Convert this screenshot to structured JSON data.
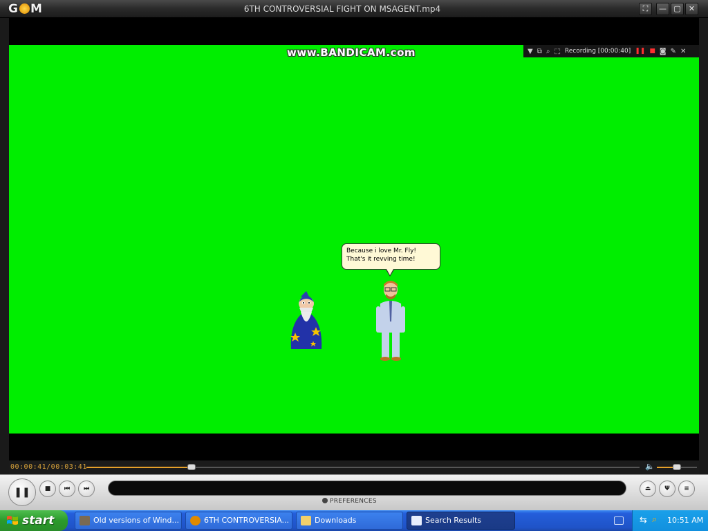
{
  "window": {
    "logo": "GOM",
    "title": "6TH CONTROVERSIAL FIGHT ON MSAGENT.mp4",
    "buttons": {
      "fullscreen": "⛶",
      "minimize": "—",
      "maximize": "▢",
      "close": "✕"
    }
  },
  "video": {
    "watermark": "www.BANDICAM.com",
    "recording_bar": {
      "status_text": "Recording [00:00:40]"
    },
    "speech_bubble": "Because i love Mr. Fly! That's it revving time!",
    "characters": [
      "wizard",
      "businessman"
    ]
  },
  "playback": {
    "timecode": "00:00:41/00:03:41",
    "progress_fraction": 0.19,
    "volume_fraction": 0.5,
    "preferences_label": "PREFERENCES"
  },
  "taskbar": {
    "start_label": "start",
    "tasks": [
      {
        "label": "Old versions of Wind...",
        "active": false
      },
      {
        "label": "6TH CONTROVERSIA...",
        "active": false
      },
      {
        "label": "Downloads",
        "active": false
      },
      {
        "label": "Search Results",
        "active": true
      }
    ],
    "clock": "10:51 AM"
  },
  "colors": {
    "greenscreen": "#00ee00",
    "accent": "#e6a02a",
    "xp_blue": "#245edb",
    "xp_green": "#2b9a2b"
  },
  "icons": [
    "gom-logo-icon",
    "fullscreen-icon",
    "minimize-icon",
    "maximize-icon",
    "close-icon",
    "pause-icon",
    "stop-icon",
    "prev-icon",
    "next-icon",
    "eject-icon",
    "equalizer-icon",
    "menu-icon",
    "volume-icon",
    "windows-flag-icon",
    "keyboard-icon",
    "search-icon"
  ]
}
